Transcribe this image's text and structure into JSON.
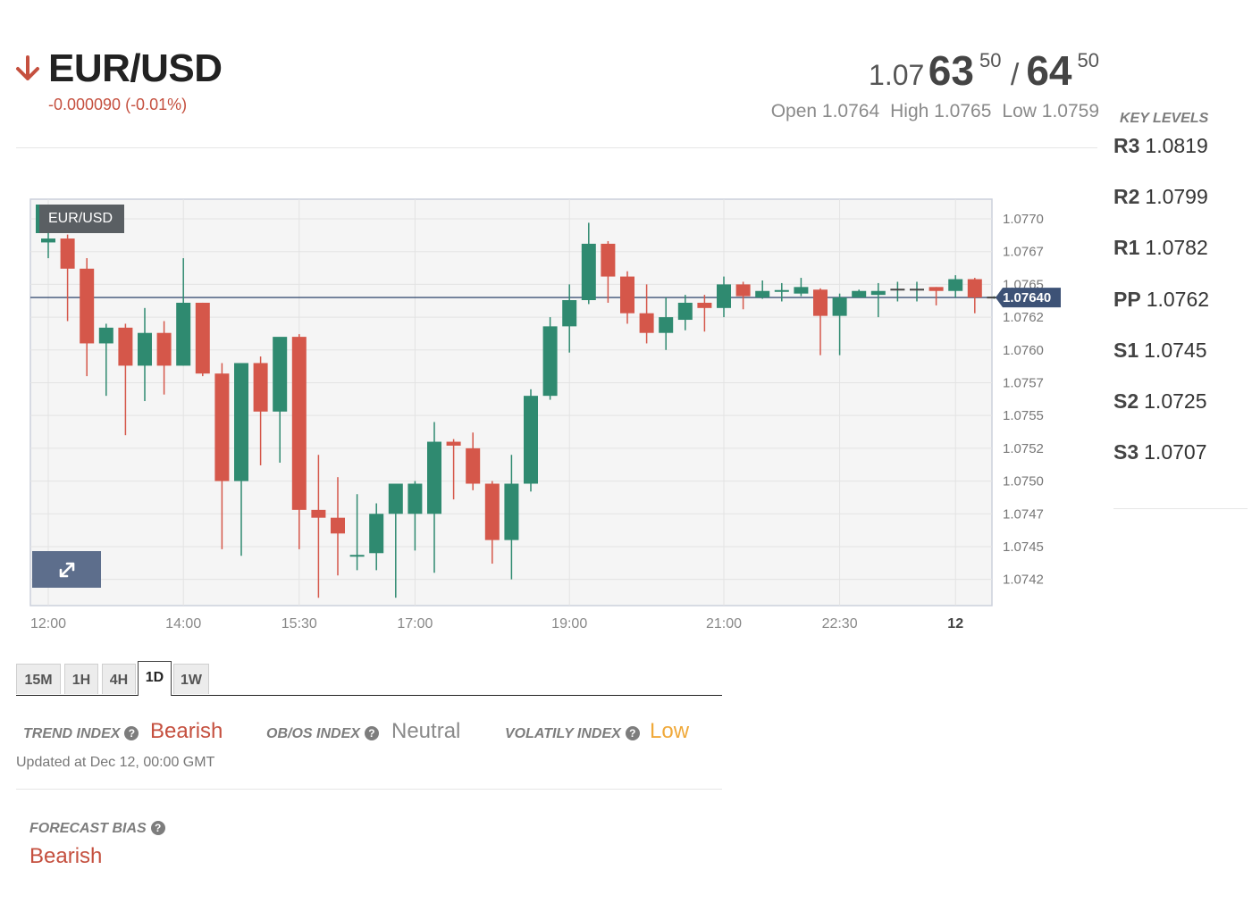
{
  "header": {
    "symbol": "EUR/USD",
    "change": "-0.000090 (-0.01%)",
    "direction": "down",
    "bid": {
      "prefix": "1.07",
      "main": "63",
      "pip": "50"
    },
    "ask": {
      "main": "64",
      "pip": "50"
    },
    "open": "Open 1.0764",
    "high": "High 1.0765",
    "low": "Low 1.0759"
  },
  "key_levels": {
    "title": "KEY LEVELS",
    "items": [
      {
        "label": "R3",
        "value": "1.0819"
      },
      {
        "label": "R2",
        "value": "1.0799"
      },
      {
        "label": "R1",
        "value": "1.0782"
      },
      {
        "label": "PP",
        "value": "1.0762"
      },
      {
        "label": "S1",
        "value": "1.0745"
      },
      {
        "label": "S2",
        "value": "1.0725"
      },
      {
        "label": "S3",
        "value": "1.0707"
      }
    ]
  },
  "chart_data": {
    "type": "candlestick",
    "tag": "EUR/USD",
    "current_price_label": "1.07640",
    "current_price": 1.0764,
    "ylim": [
      1.07405,
      1.07715
    ],
    "y_ticks": [
      "1.0770",
      "1.0767",
      "1.0765",
      "1.0762",
      "1.0760",
      "1.0757",
      "1.0755",
      "1.0752",
      "1.0750",
      "1.0747",
      "1.0745",
      "1.0742"
    ],
    "y_tick_values": [
      1.077,
      1.07675,
      1.0765,
      1.07625,
      1.076,
      1.07575,
      1.0755,
      1.07525,
      1.075,
      1.07475,
      1.0745,
      1.07425
    ],
    "x_ticks": [
      {
        "label": "12:00",
        "index": 0
      },
      {
        "label": "14:00",
        "index": 7
      },
      {
        "label": "15:30",
        "index": 13
      },
      {
        "label": "17:00",
        "index": 19
      },
      {
        "label": "19:00",
        "index": 27
      },
      {
        "label": "21:00",
        "index": 35
      },
      {
        "label": "22:30",
        "index": 41
      },
      {
        "label": "12",
        "index": 47,
        "bold": true
      }
    ],
    "candles": [
      {
        "o": 1.07682,
        "h": 1.07705,
        "l": 1.0767,
        "c": 1.07685
      },
      {
        "o": 1.07685,
        "h": 1.07688,
        "l": 1.07622,
        "c": 1.07662
      },
      {
        "o": 1.07662,
        "h": 1.0767,
        "l": 1.0758,
        "c": 1.07605
      },
      {
        "o": 1.07605,
        "h": 1.0762,
        "l": 1.07565,
        "c": 1.07617
      },
      {
        "o": 1.07617,
        "h": 1.0762,
        "l": 1.07535,
        "c": 1.07588
      },
      {
        "o": 1.07588,
        "h": 1.07632,
        "l": 1.07561,
        "c": 1.07613
      },
      {
        "o": 1.07613,
        "h": 1.07622,
        "l": 1.07566,
        "c": 1.07588
      },
      {
        "o": 1.07588,
        "h": 1.0767,
        "l": 1.07588,
        "c": 1.07636
      },
      {
        "o": 1.07636,
        "h": 1.07636,
        "l": 1.0758,
        "c": 1.07582
      },
      {
        "o": 1.07582,
        "h": 1.0759,
        "l": 1.07448,
        "c": 1.075
      },
      {
        "o": 1.075,
        "h": 1.0759,
        "l": 1.07443,
        "c": 1.0759
      },
      {
        "o": 1.0759,
        "h": 1.07595,
        "l": 1.07512,
        "c": 1.07553
      },
      {
        "o": 1.07553,
        "h": 1.07603,
        "l": 1.07514,
        "c": 1.0761
      },
      {
        "o": 1.0761,
        "h": 1.07612,
        "l": 1.07448,
        "c": 1.07478
      },
      {
        "o": 1.07478,
        "h": 1.0752,
        "l": 1.07411,
        "c": 1.07472
      },
      {
        "o": 1.07472,
        "h": 1.07503,
        "l": 1.07428,
        "c": 1.0746
      },
      {
        "o": 1.07442,
        "h": 1.0749,
        "l": 1.07432,
        "c": 1.07443
      },
      {
        "o": 1.07445,
        "h": 1.07483,
        "l": 1.07432,
        "c": 1.07475
      },
      {
        "o": 1.07475,
        "h": 1.07495,
        "l": 1.07411,
        "c": 1.07498
      },
      {
        "o": 1.07475,
        "h": 1.075,
        "l": 1.07447,
        "c": 1.07498
      },
      {
        "o": 1.07475,
        "h": 1.07545,
        "l": 1.0743,
        "c": 1.0753
      },
      {
        "o": 1.0753,
        "h": 1.07532,
        "l": 1.07486,
        "c": 1.07527
      },
      {
        "o": 1.07525,
        "h": 1.07537,
        "l": 1.07493,
        "c": 1.07498
      },
      {
        "o": 1.07498,
        "h": 1.075,
        "l": 1.07437,
        "c": 1.07455
      },
      {
        "o": 1.07455,
        "h": 1.0752,
        "l": 1.07425,
        "c": 1.07498
      },
      {
        "o": 1.07498,
        "h": 1.0757,
        "l": 1.07492,
        "c": 1.07565
      },
      {
        "o": 1.07565,
        "h": 1.07625,
        "l": 1.07562,
        "c": 1.07618
      },
      {
        "o": 1.07618,
        "h": 1.0765,
        "l": 1.07598,
        "c": 1.07638
      },
      {
        "o": 1.07638,
        "h": 1.07697,
        "l": 1.07635,
        "c": 1.07681
      },
      {
        "o": 1.07681,
        "h": 1.07683,
        "l": 1.07636,
        "c": 1.07656
      },
      {
        "o": 1.07656,
        "h": 1.0766,
        "l": 1.0762,
        "c": 1.07628
      },
      {
        "o": 1.07628,
        "h": 1.0765,
        "l": 1.07605,
        "c": 1.07613
      },
      {
        "o": 1.07613,
        "h": 1.0764,
        "l": 1.076,
        "c": 1.07625
      },
      {
        "o": 1.07623,
        "h": 1.07642,
        "l": 1.07615,
        "c": 1.07636
      },
      {
        "o": 1.07636,
        "h": 1.07642,
        "l": 1.07614,
        "c": 1.07632
      },
      {
        "o": 1.07632,
        "h": 1.07656,
        "l": 1.07625,
        "c": 1.0765
      },
      {
        "o": 1.0765,
        "h": 1.07652,
        "l": 1.07631,
        "c": 1.07641
      },
      {
        "o": 1.0764,
        "h": 1.07653,
        "l": 1.07639,
        "c": 1.07645
      },
      {
        "o": 1.07644,
        "h": 1.07651,
        "l": 1.07637,
        "c": 1.07645
      },
      {
        "o": 1.07643,
        "h": 1.07655,
        "l": 1.07641,
        "c": 1.07648
      },
      {
        "o": 1.07646,
        "h": 1.07647,
        "l": 1.07596,
        "c": 1.07626
      },
      {
        "o": 1.07626,
        "h": 1.07643,
        "l": 1.07596,
        "c": 1.0764
      },
      {
        "o": 1.0764,
        "h": 1.07646,
        "l": 1.0764,
        "c": 1.07645
      },
      {
        "o": 1.07642,
        "h": 1.07651,
        "l": 1.07625,
        "c": 1.07645
      },
      {
        "o": 1.07646,
        "h": 1.07652,
        "l": 1.07637,
        "c": 1.07646
      },
      {
        "o": 1.07646,
        "h": 1.07652,
        "l": 1.07637,
        "c": 1.07646
      },
      {
        "o": 1.07648,
        "h": 1.07648,
        "l": 1.07634,
        "c": 1.07645
      },
      {
        "o": 1.07645,
        "h": 1.07657,
        "l": 1.0764,
        "c": 1.07654
      },
      {
        "o": 1.07654,
        "h": 1.07655,
        "l": 1.07628,
        "c": 1.0764
      },
      {
        "o": 1.0764,
        "h": 1.07641,
        "l": 1.07639,
        "c": 1.0764
      }
    ]
  },
  "timeframes": {
    "items": [
      "15M",
      "1H",
      "4H",
      "1D",
      "1W"
    ],
    "active": "1D"
  },
  "indexes": {
    "trend_label": "TREND INDEX",
    "trend_value": "Bearish",
    "obos_label": "OB/OS INDEX",
    "obos_value": "Neutral",
    "volatility_label": "VOLATILY INDEX",
    "volatility_value": "Low",
    "help_icon": "?",
    "updated": "Updated at Dec 12, 00:00 GMT"
  },
  "forecast": {
    "label": "FORECAST BIAS",
    "value": "Bearish"
  },
  "colors": {
    "up": "#2f8a70",
    "down": "#d5574a",
    "bearish": "#c5503f",
    "neutral": "#8a8a8a",
    "low": "#f0a93a",
    "price_line": "#3d5276"
  }
}
